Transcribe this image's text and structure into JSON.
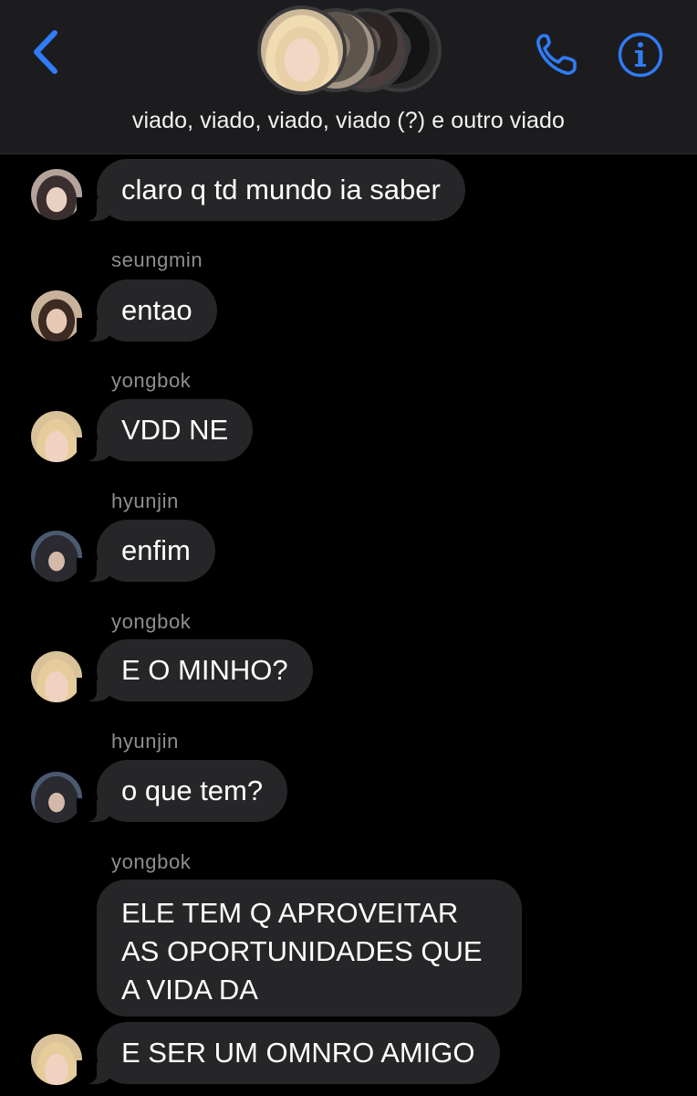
{
  "header": {
    "group_name": "viado, viado, viado, viado (?) e outro viado",
    "back_icon": "chevron-left-icon",
    "call_icon": "phone-icon",
    "info_icon": "info-icon",
    "accent_color": "#2f7cf6"
  },
  "messages": [
    {
      "sender": "",
      "text": "claro q td mundo ia saber"
    },
    {
      "sender": "seungmin",
      "text": "entao"
    },
    {
      "sender": "yongbok",
      "text": "VDD NE"
    },
    {
      "sender": "hyunjin",
      "text": "enfim"
    },
    {
      "sender": "yongbok",
      "text": "E O MINHO?"
    },
    {
      "sender": "hyunjin",
      "text": "o que tem?"
    },
    {
      "sender": "yongbok",
      "text": "ELE TEM Q APROVEITAR AS OPORTUNIDADES QUE A VIDA DA"
    },
    {
      "sender": "",
      "text": "E SER UM OMNRO AMIGO"
    }
  ]
}
